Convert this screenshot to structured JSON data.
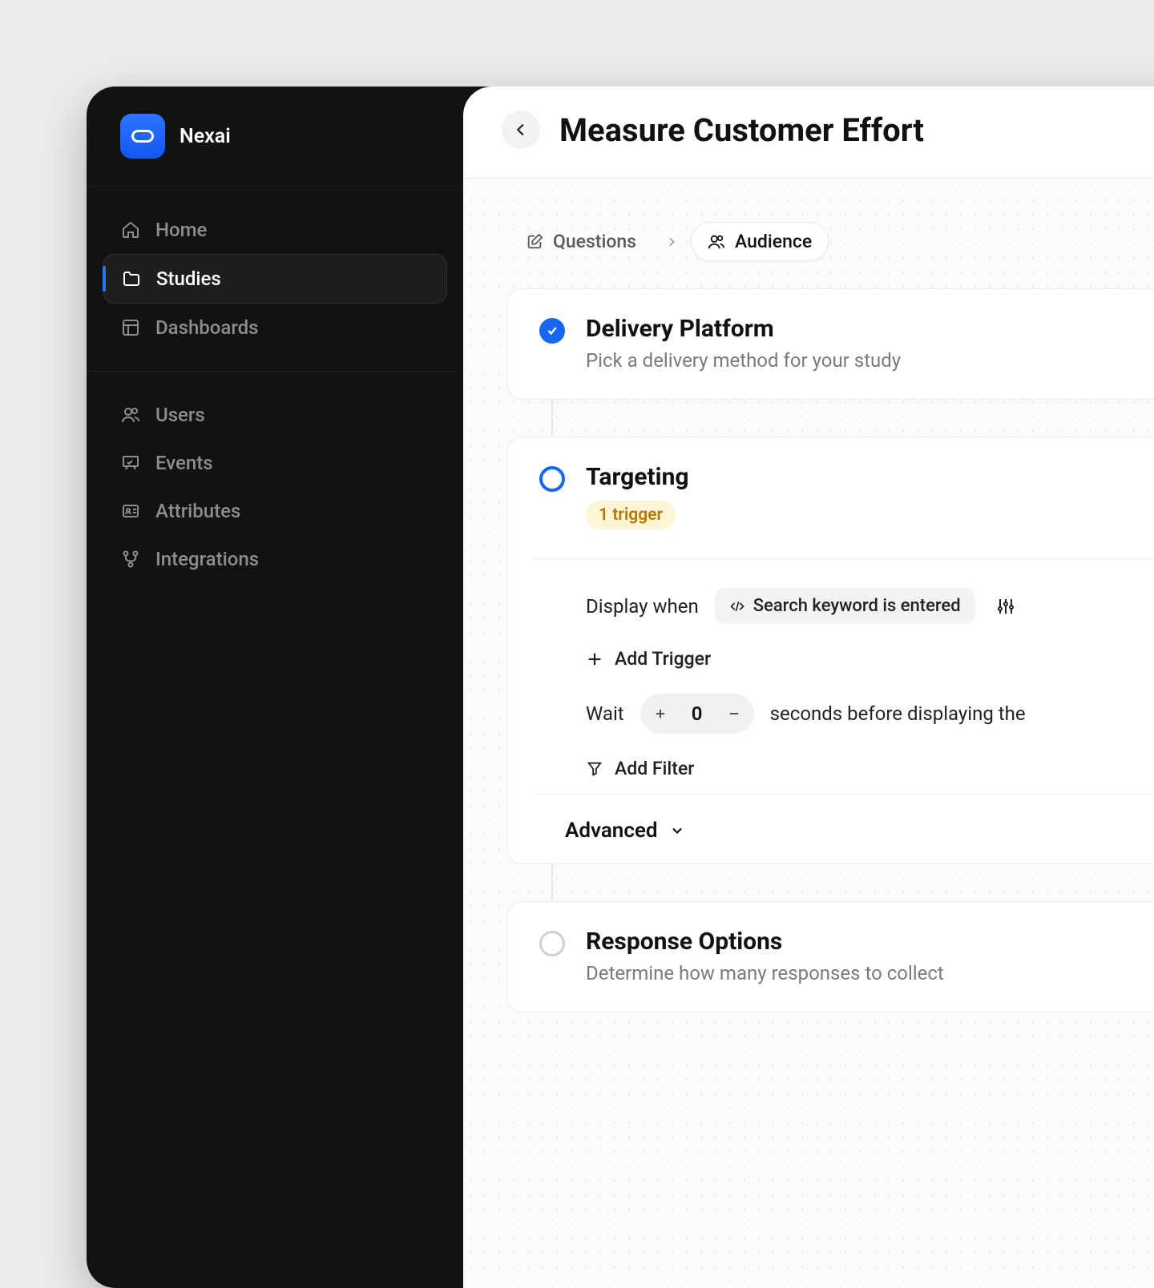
{
  "brand": {
    "name": "Nexai"
  },
  "nav": {
    "group1": [
      {
        "label": "Home",
        "icon": "home"
      },
      {
        "label": "Studies",
        "icon": "folder",
        "active": true
      },
      {
        "label": "Dashboards",
        "icon": "layout"
      }
    ],
    "group2": [
      {
        "label": "Users",
        "icon": "users"
      },
      {
        "label": "Events",
        "icon": "presentation"
      },
      {
        "label": "Attributes",
        "icon": "id"
      },
      {
        "label": "Integrations",
        "icon": "branch"
      }
    ]
  },
  "header": {
    "title": "Measure Customer Effort"
  },
  "tabs": {
    "questions": "Questions",
    "audience": "Audience"
  },
  "delivery": {
    "title": "Delivery Platform",
    "sub": "Pick a delivery method for your study"
  },
  "targeting": {
    "title": "Targeting",
    "badge": "1 trigger",
    "display_when_label": "Display when",
    "trigger_chip": "Search keyword is entered",
    "add_trigger": "Add Trigger",
    "wait_label": "Wait",
    "wait_value": "0",
    "wait_suffix": "seconds before displaying the",
    "add_filter": "Add Filter",
    "advanced": "Advanced"
  },
  "response": {
    "title": "Response Options",
    "sub": "Determine how many responses to collect"
  }
}
